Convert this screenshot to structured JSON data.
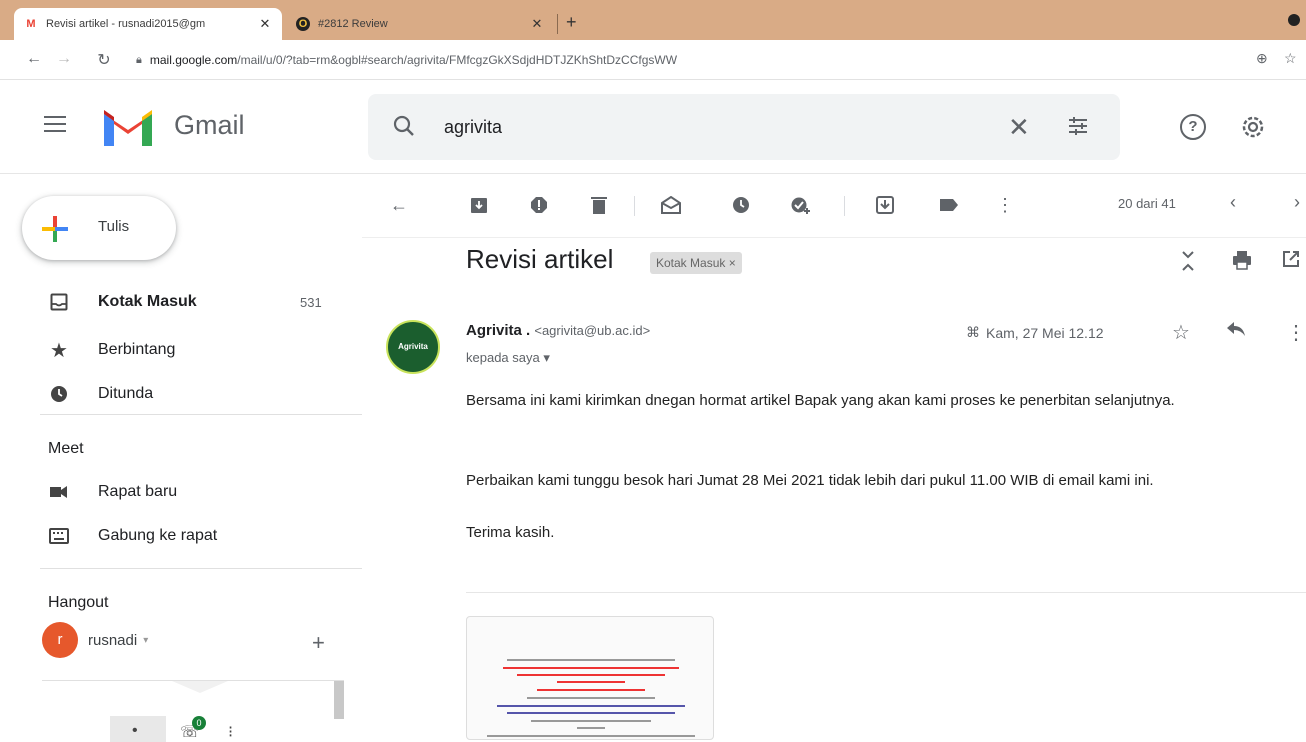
{
  "browser": {
    "tabs": [
      {
        "title": "Revisi artikel - rusnadi2015@gm",
        "favicon": "M"
      },
      {
        "title": "#2812 Review",
        "favicon": "O"
      }
    ],
    "url_host": "mail.google.com",
    "url_path": "/mail/u/0/?tab=rm&ogbl#search/agrivita/FMfcgzGkXSdjdHDTJZKhShtDzCCfgsWW"
  },
  "header": {
    "app_name": "Gmail",
    "search_query": "agrivita"
  },
  "sidebar": {
    "compose_label": "Tulis",
    "items": [
      {
        "label": "Kotak Masuk",
        "count": "531"
      },
      {
        "label": "Berbintang"
      },
      {
        "label": "Ditunda"
      }
    ],
    "meet_title": "Meet",
    "meet_items": [
      {
        "label": "Rapat baru"
      },
      {
        "label": "Gabung ke rapat"
      }
    ],
    "hangout_title": "Hangout",
    "hangout_user": "rusnadi",
    "hangout_user_initial": "r",
    "badge_count": "0"
  },
  "toolbar": {
    "pager": "20 dari 41"
  },
  "message": {
    "subject": "Revisi artikel",
    "label": "Kotak Masuk ×",
    "sender_name": "Agrivita .",
    "sender_email": "<agrivita@ub.ac.id>",
    "avatar_text": "Agrivita",
    "to": "kepada saya ▾",
    "date": "Kam, 27 Mei 12.12",
    "body": [
      "Bersama ini kami kirimkan dnegan hormat artikel Bapak yang akan kami proses ke penerbitan selanjutnya.",
      "Perbaikan kami tunggu besok hari Jumat 28 Mei 2021 tidak lebih dari pukul 11.00 WIB di email kami ini.",
      "Terima kasih."
    ]
  },
  "colors": {
    "tabbar": "#d9ab86",
    "accent_red": "#ea4335",
    "avatar_green": "#1b5e2e"
  }
}
